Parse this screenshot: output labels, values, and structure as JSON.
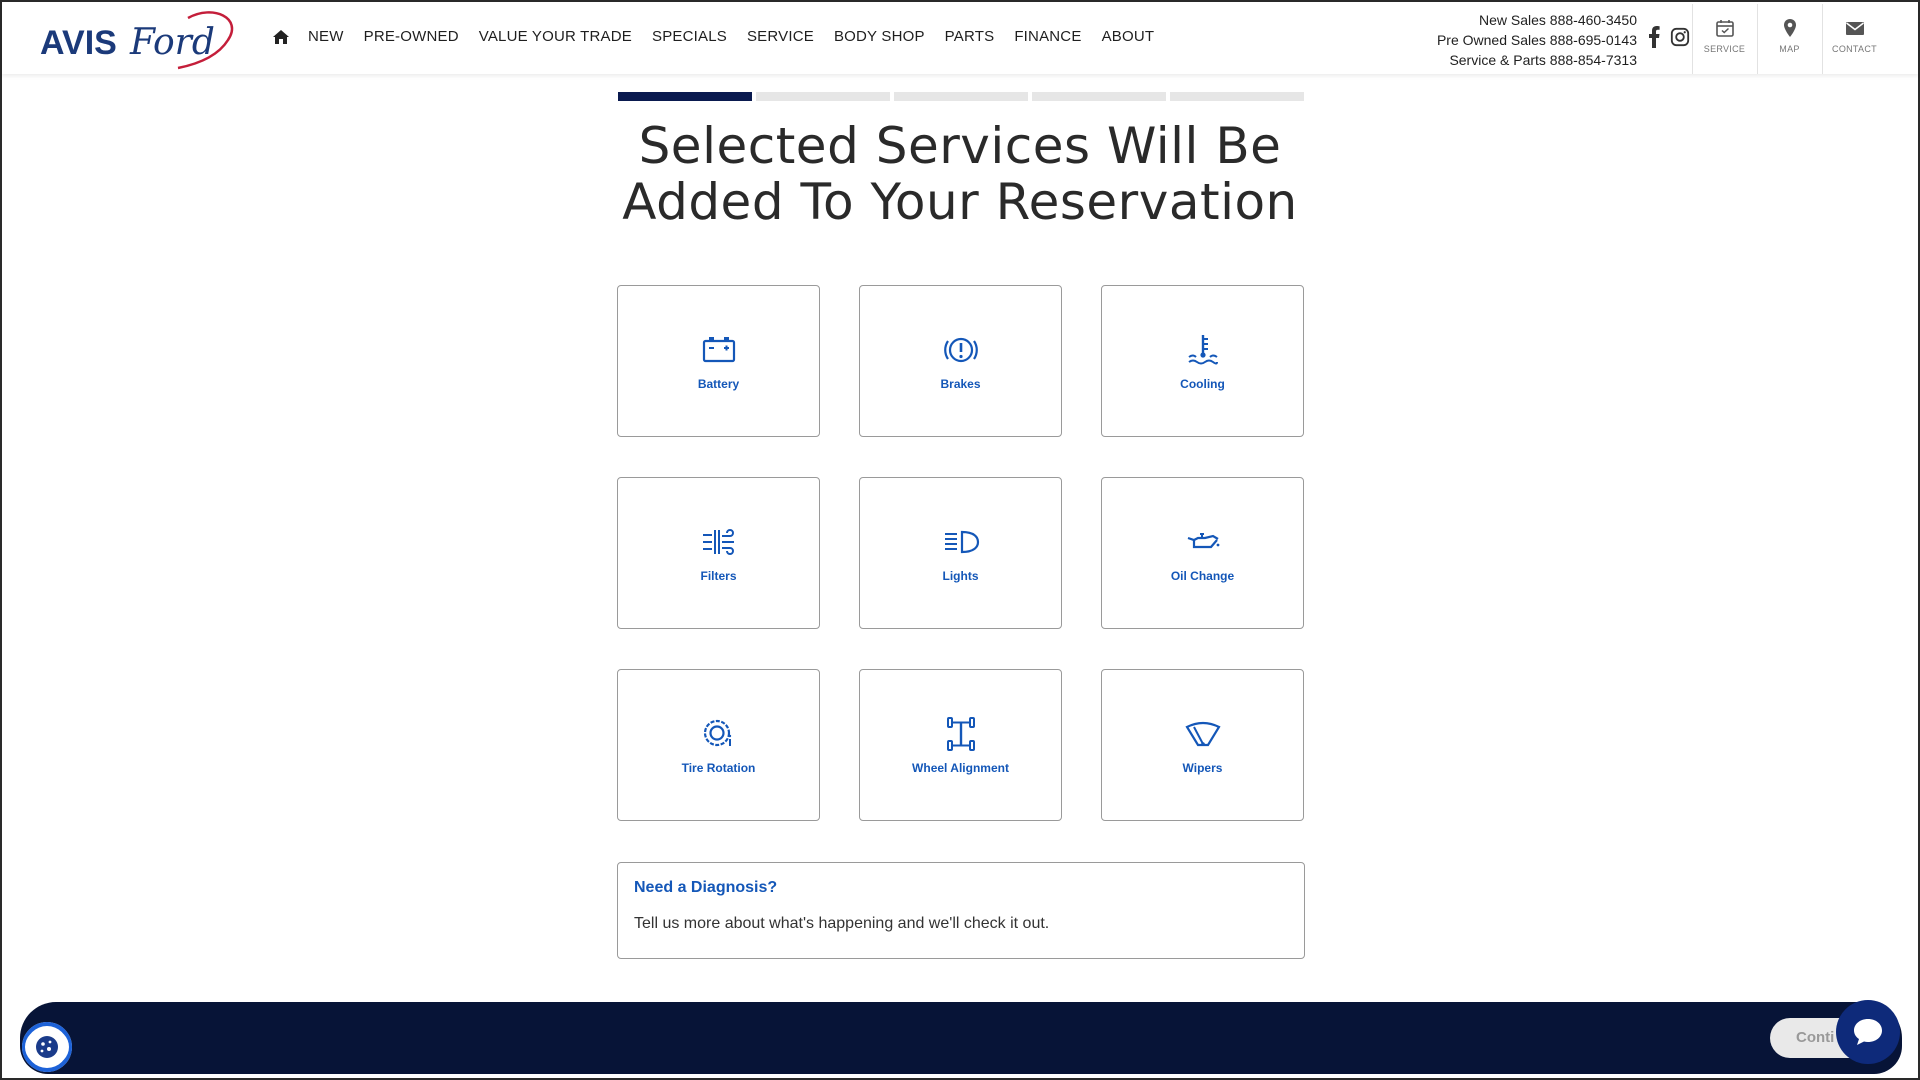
{
  "brand": {
    "logo_text_left": "AVIS",
    "logo_text_right": "Ford",
    "primary_color": "#0a1a4f",
    "accent_color": "#1457b8"
  },
  "nav": {
    "home_icon": "home-icon",
    "items": [
      {
        "label": "NEW"
      },
      {
        "label": "PRE-OWNED"
      },
      {
        "label": "VALUE YOUR TRADE"
      },
      {
        "label": "SPECIALS"
      },
      {
        "label": "SERVICE"
      },
      {
        "label": "BODY SHOP"
      },
      {
        "label": "PARTS"
      },
      {
        "label": "FINANCE"
      },
      {
        "label": "ABOUT"
      }
    ]
  },
  "phones": {
    "new_sales": "New Sales 888-460-3450",
    "pre_owned_sales": "Pre Owned Sales 888-695-0143",
    "service_parts": "Service & Parts 888-854-7313"
  },
  "header_buttons": {
    "service": "SERVICE",
    "map": "MAP",
    "contact": "CONTACT"
  },
  "progress": {
    "total_steps": 5,
    "current_step": 1
  },
  "page": {
    "title_line1": "Selected Services Will Be",
    "title_line2": "Added To Your Reservation"
  },
  "services": [
    {
      "label": "Battery",
      "icon": "battery-icon"
    },
    {
      "label": "Brakes",
      "icon": "brake-warning-icon"
    },
    {
      "label": "Cooling",
      "icon": "coolant-temperature-icon"
    },
    {
      "label": "Filters",
      "icon": "air-filter-icon"
    },
    {
      "label": "Lights",
      "icon": "headlight-icon"
    },
    {
      "label": "Oil Change",
      "icon": "oil-can-icon"
    },
    {
      "label": "Tire Rotation",
      "icon": "tire-pressure-icon"
    },
    {
      "label": "Wheel Alignment",
      "icon": "wheel-alignment-icon"
    },
    {
      "label": "Wipers",
      "icon": "wiper-icon"
    }
  ],
  "diagnosis": {
    "title": "Need a Diagnosis?",
    "text": "Tell us more about what's happening and we'll check it out."
  },
  "footer": {
    "continue_label": "Conti"
  }
}
